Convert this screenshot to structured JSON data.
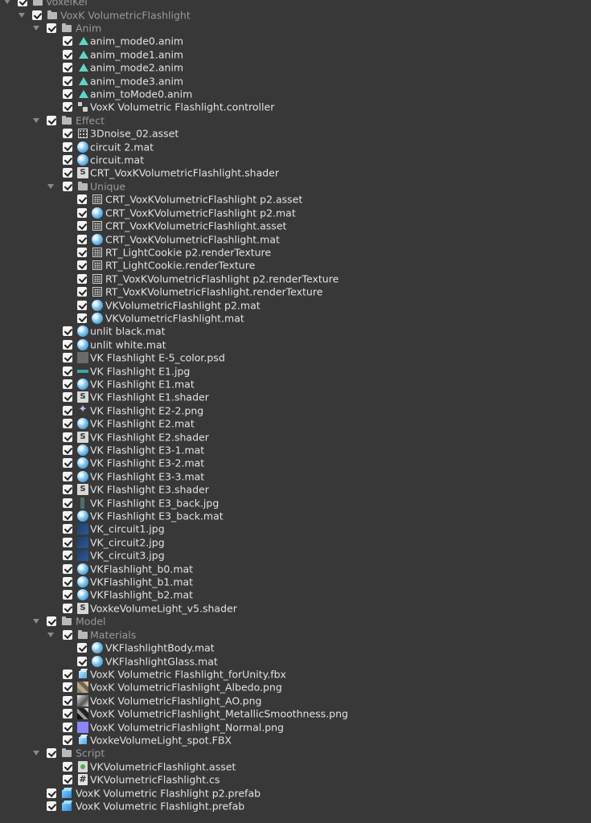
{
  "tree": [
    {
      "level": 0,
      "arrow": true,
      "icon": "folder-icon",
      "folder": true,
      "label": "VoxelKei"
    },
    {
      "level": 1,
      "arrow": true,
      "icon": "folder-icon",
      "folder": true,
      "label": "VoxK VolumetricFlashlight"
    },
    {
      "level": 2,
      "arrow": true,
      "icon": "folder-icon",
      "folder": true,
      "label": "Anim"
    },
    {
      "level": 3,
      "icon": "animation-clip-icon",
      "label": "anim_mode0.anim"
    },
    {
      "level": 3,
      "icon": "animation-clip-icon",
      "label": "anim_mode1.anim"
    },
    {
      "level": 3,
      "icon": "animation-clip-icon",
      "label": "anim_mode2.anim"
    },
    {
      "level": 3,
      "icon": "animation-clip-icon",
      "label": "anim_mode3.anim"
    },
    {
      "level": 3,
      "icon": "animation-clip-icon",
      "label": "anim_toMode0.anim"
    },
    {
      "level": 3,
      "icon": "animator-controller-icon",
      "label": "VoxK Volumetric Flashlight.controller"
    },
    {
      "level": 2,
      "arrow": true,
      "icon": "folder-icon",
      "folder": true,
      "label": "Effect"
    },
    {
      "level": 3,
      "icon": "noise-texture-asset-icon",
      "label": "3Dnoise_02.asset"
    },
    {
      "level": 3,
      "icon": "material-icon",
      "label": "circuit 2.mat"
    },
    {
      "level": 3,
      "icon": "material-icon",
      "label": "circuit.mat"
    },
    {
      "level": 3,
      "icon": "shader-icon",
      "label": "CRT_VoxKVolumetricFlashlight.shader"
    },
    {
      "level": 3,
      "arrow": true,
      "icon": "folder-icon",
      "folder": true,
      "label": "Unique"
    },
    {
      "level": 4,
      "icon": "render-texture-asset-icon",
      "label": "CRT_VoxKVolumetricFlashlight p2.asset"
    },
    {
      "level": 4,
      "icon": "material-icon",
      "label": "CRT_VoxKVolumetricFlashlight p2.mat"
    },
    {
      "level": 4,
      "icon": "render-texture-asset-icon",
      "label": "CRT_VoxKVolumetricFlashlight.asset"
    },
    {
      "level": 4,
      "icon": "material-icon",
      "label": "CRT_VoxKVolumetricFlashlight.mat"
    },
    {
      "level": 4,
      "icon": "render-texture-icon",
      "label": "RT_LightCookie p2.renderTexture"
    },
    {
      "level": 4,
      "icon": "render-texture-icon",
      "label": "RT_LightCookie.renderTexture"
    },
    {
      "level": 4,
      "icon": "render-texture-icon",
      "label": "RT_VoxKVolumetricFlashlight p2.renderTexture"
    },
    {
      "level": 4,
      "icon": "render-texture-icon",
      "label": "RT_VoxKVolumetricFlashlight.renderTexture"
    },
    {
      "level": 4,
      "icon": "material-icon",
      "label": "VKVolumetricFlashlight p2.mat"
    },
    {
      "level": 4,
      "icon": "material-icon",
      "label": "VKVolumetricFlashlight.mat"
    },
    {
      "level": 3,
      "icon": "material-icon",
      "label": "unlit black.mat"
    },
    {
      "level": 3,
      "icon": "material-icon",
      "label": "unlit white.mat"
    },
    {
      "level": 3,
      "icon": "psd-texture-icon",
      "label": "VK Flashlight E-5_color.psd"
    },
    {
      "level": 3,
      "icon": "teal-texture-icon",
      "label": "VK Flashlight E1.jpg"
    },
    {
      "level": 3,
      "icon": "material-icon",
      "label": "VK Flashlight E1.mat"
    },
    {
      "level": 3,
      "icon": "shader-icon",
      "label": "VK Flashlight E1.shader"
    },
    {
      "level": 3,
      "icon": "flare-texture-icon",
      "label": "VK Flashlight E2-2.png"
    },
    {
      "level": 3,
      "icon": "material-icon",
      "label": "VK Flashlight E2.mat"
    },
    {
      "level": 3,
      "icon": "shader-icon",
      "label": "VK Flashlight E2.shader"
    },
    {
      "level": 3,
      "icon": "material-icon",
      "label": "VK Flashlight E3-1.mat"
    },
    {
      "level": 3,
      "icon": "material-icon",
      "label": "VK Flashlight E3-2.mat"
    },
    {
      "level": 3,
      "icon": "material-icon",
      "label": "VK Flashlight E3-3.mat"
    },
    {
      "level": 3,
      "icon": "shader-icon",
      "label": "VK Flashlight E3.shader"
    },
    {
      "level": 3,
      "icon": "strip-texture-icon",
      "label": "VK Flashlight E3_back.jpg"
    },
    {
      "level": 3,
      "icon": "material-icon",
      "label": "VK Flashlight E3_back.mat"
    },
    {
      "level": 3,
      "icon": "circuit-texture-icon",
      "label": "VK_circuit1.jpg"
    },
    {
      "level": 3,
      "icon": "circuit-texture-icon",
      "label": "VK_circuit2.jpg"
    },
    {
      "level": 3,
      "icon": "circuit-texture-icon",
      "label": "VK_circuit3.jpg"
    },
    {
      "level": 3,
      "icon": "material-icon",
      "label": "VKFlashlight_b0.mat"
    },
    {
      "level": 3,
      "icon": "material-icon",
      "label": "VKFlashlight_b1.mat"
    },
    {
      "level": 3,
      "icon": "material-icon",
      "label": "VKFlashlight_b2.mat"
    },
    {
      "level": 3,
      "icon": "shader-icon",
      "label": "VoxkeVolumeLight_v5.shader"
    },
    {
      "level": 2,
      "arrow": true,
      "icon": "folder-icon",
      "folder": true,
      "label": "Model"
    },
    {
      "level": 3,
      "arrow": true,
      "icon": "folder-icon",
      "folder": true,
      "label": "Materials"
    },
    {
      "level": 4,
      "icon": "material-icon",
      "label": "VKFlashlightBody.mat"
    },
    {
      "level": 4,
      "icon": "material-icon",
      "label": "VKFlashlightGlass.mat"
    },
    {
      "level": 3,
      "icon": "model-icon",
      "label": "VoxK Volumetric Flashlight_forUnity.fbx"
    },
    {
      "level": 3,
      "icon": "albedo-texture-icon",
      "label": "VoxK VolumetricFlashlight_Albedo.png"
    },
    {
      "level": 3,
      "icon": "ao-texture-icon",
      "label": "VoxK VolumetricFlashlight_AO.png"
    },
    {
      "level": 3,
      "icon": "metallic-texture-icon",
      "label": "VoxK VolumetricFlashlight_MetallicSmoothness.png"
    },
    {
      "level": 3,
      "icon": "normal-map-icon",
      "label": "VoxK VolumetricFlashlight_Normal.png"
    },
    {
      "level": 3,
      "icon": "model-icon",
      "label": "VoxkeVolumeLight_spot.FBX"
    },
    {
      "level": 2,
      "arrow": true,
      "icon": "folder-icon",
      "folder": true,
      "label": "Script"
    },
    {
      "level": 3,
      "icon": "scriptable-asset-icon",
      "label": "VKVolumetricFlashlight.asset"
    },
    {
      "level": 3,
      "icon": "csharp-script-icon",
      "label": "VKVolumetricFlashlight.cs"
    },
    {
      "level": 2,
      "icon": "prefab-icon",
      "label": "VoxK Volumetric Flashlight p2.prefab"
    },
    {
      "level": 2,
      "icon": "prefab-icon",
      "label": "VoxK Volumetric Flashlight.prefab"
    }
  ]
}
